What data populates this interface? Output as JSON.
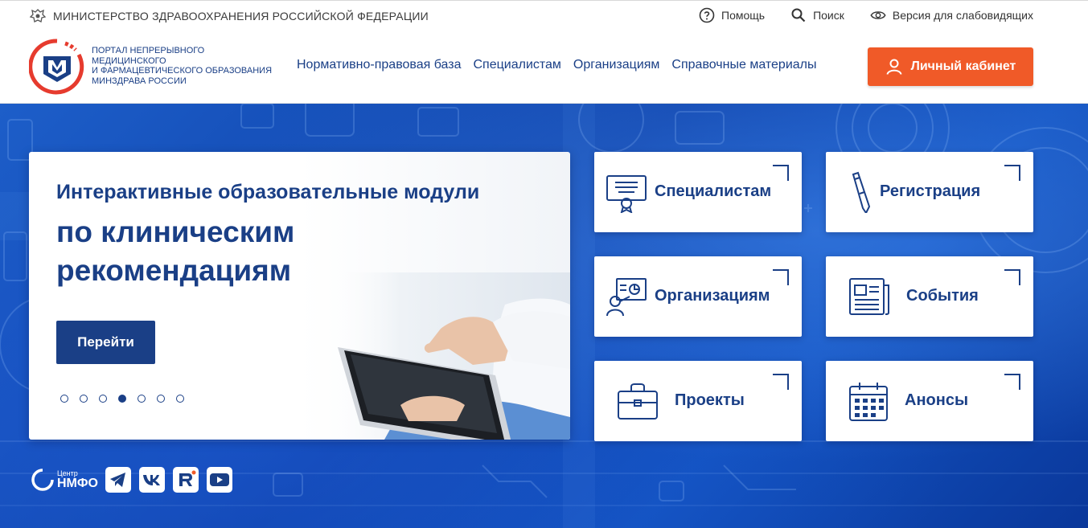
{
  "topbar": {
    "ministry": "МИНИСТЕРСТВО ЗДРАВООХРАНЕНИЯ РОССИЙСКОЙ ФЕДЕРАЦИИ",
    "links": [
      {
        "label": "Помощь",
        "icon": "help-circle-icon"
      },
      {
        "label": "Поиск",
        "icon": "search-icon"
      },
      {
        "label": "Версия для слабовидящих",
        "icon": "eye-icon"
      }
    ]
  },
  "header": {
    "portal_name": [
      "ПОРТАЛ НЕПРЕРЫВНОГО",
      "МЕДИЦИНСКОГО",
      "И ФАРМАЦЕВТИЧЕСКОГО ОБРАЗОВАНИЯ",
      "МИНЗДРАВА РОССИИ"
    ],
    "nav": [
      "Нормативно-правовая база",
      "Специалистам",
      "Организациям",
      "Справочные материалы"
    ],
    "cabinet_label": "Личный кабинет"
  },
  "slide": {
    "title1": "Интерактивные образовательные модули",
    "title2": "по клиническим рекомендациям",
    "button": "Перейти",
    "dots_total": 7,
    "active_dot": 4
  },
  "tiles": [
    {
      "label": "Специалистам",
      "icon": "certificate-icon"
    },
    {
      "label": "Регистрация",
      "icon": "pen-icon"
    },
    {
      "label": "Организациям",
      "icon": "presenter-icon"
    },
    {
      "label": "События",
      "icon": "newspaper-icon"
    },
    {
      "label": "Проекты",
      "icon": "briefcase-icon"
    },
    {
      "label": "Анонсы",
      "icon": "calendar-icon"
    }
  ],
  "socials": {
    "nmfo_small": "Центр",
    "nmfo_big": "НМФО",
    "items": [
      "telegram-icon",
      "vk-icon",
      "rutube-icon",
      "youtube-icon"
    ]
  },
  "colors": {
    "brand": "#1a3f86",
    "accent": "#f05a28",
    "hero": "#0d40a8"
  }
}
